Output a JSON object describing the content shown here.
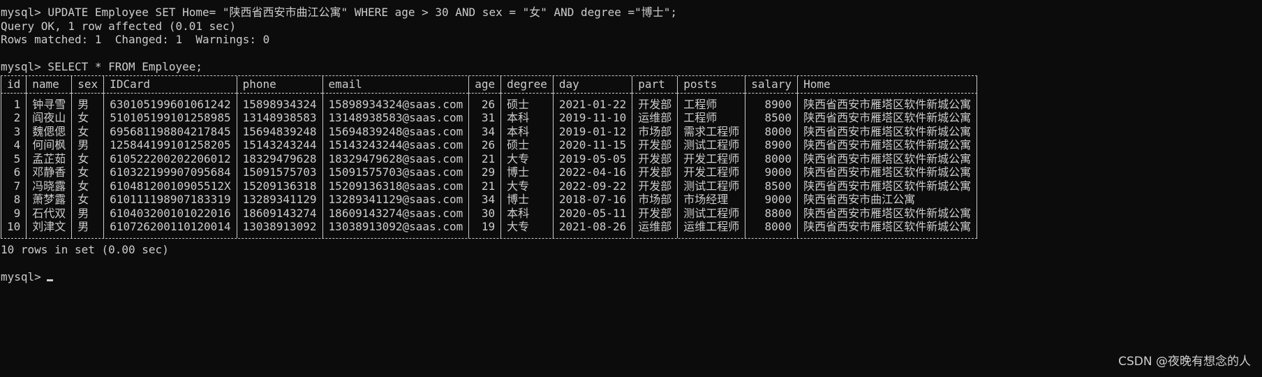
{
  "terminal": {
    "command1": "mysql> UPDATE Employee SET Home= \"陕西省西安市曲江公寓\" WHERE age > 30 AND sex = \"女\" AND degree =\"博士\";",
    "result1_line1": "Query OK, 1 row affected (0.01 sec)",
    "result1_line2": "Rows matched: 1  Changed: 1  Warnings: 0",
    "command2": "mysql> SELECT * FROM Employee;",
    "rows_summary": "10 rows in set (0.00 sec)",
    "prompt": "mysql>"
  },
  "table": {
    "headers": [
      "id",
      "name",
      "sex",
      "IDCard",
      "phone",
      "email",
      "age",
      "degree",
      "day",
      "part",
      "posts",
      "salary",
      "Home"
    ],
    "rows": [
      [
        "1",
        "钟寻雪",
        "男",
        "630105199601061242",
        "15898934324",
        "15898934324@saas.com",
        "26",
        "硕士",
        "2021-01-22",
        "开发部",
        "工程师",
        "8900",
        "陕西省西安市雁塔区软件新城公寓"
      ],
      [
        "2",
        "阎夜山",
        "女",
        "510105199101258985",
        "13148938583",
        "13148938583@saas.com",
        "31",
        "本科",
        "2019-11-10",
        "运维部",
        "工程师",
        "8500",
        "陕西省西安市雁塔区软件新城公寓"
      ],
      [
        "3",
        "魏偲偲",
        "女",
        "695681198804217845",
        "15694839248",
        "15694839248@saas.com",
        "34",
        "本科",
        "2019-01-12",
        "市场部",
        "需求工程师",
        "8000",
        "陕西省西安市雁塔区软件新城公寓"
      ],
      [
        "4",
        "何间枫",
        "男",
        "125844199101258205",
        "15143243244",
        "15143243244@saas.com",
        "26",
        "硕士",
        "2020-11-15",
        "开发部",
        "测试工程师",
        "8900",
        "陕西省西安市雁塔区软件新城公寓"
      ],
      [
        "5",
        "孟芷茹",
        "女",
        "610522200202206012",
        "18329479628",
        "18329479628@saas.com",
        "21",
        "大专",
        "2019-05-05",
        "开发部",
        "开发工程师",
        "8000",
        "陕西省西安市雁塔区软件新城公寓"
      ],
      [
        "6",
        "邓静香",
        "女",
        "610322199907095684",
        "15091575703",
        "15091575703@saas.com",
        "29",
        "博士",
        "2022-04-16",
        "开发部",
        "开发工程师",
        "9000",
        "陕西省西安市雁塔区软件新城公寓"
      ],
      [
        "7",
        "冯晓露",
        "女",
        "61048120010905512X",
        "15209136318",
        "15209136318@saas.com",
        "21",
        "大专",
        "2022-09-22",
        "开发部",
        "测试工程师",
        "8500",
        "陕西省西安市雁塔区软件新城公寓"
      ],
      [
        "8",
        "萧梦露",
        "女",
        "610111198907183319",
        "13289341129",
        "13289341129@saas.com",
        "34",
        "博士",
        "2018-07-16",
        "市场部",
        "市场经理",
        "9000",
        "陕西省西安市曲江公寓"
      ],
      [
        "9",
        "石代双",
        "男",
        "610403200101022016",
        "18609143274",
        "18609143274@saas.com",
        "30",
        "本科",
        "2020-05-11",
        "开发部",
        "测试工程师",
        "8800",
        "陕西省西安市雁塔区软件新城公寓"
      ],
      [
        "10",
        "刘津文",
        "男",
        "610726200110120014",
        "13038913092",
        "13038913092@saas.com",
        "19",
        "大专",
        "2021-08-26",
        "运维部",
        "运维工程师",
        "8000",
        "陕西省西安市雁塔区软件新城公寓"
      ]
    ]
  },
  "watermark": "CSDN @夜晚有想念的人"
}
